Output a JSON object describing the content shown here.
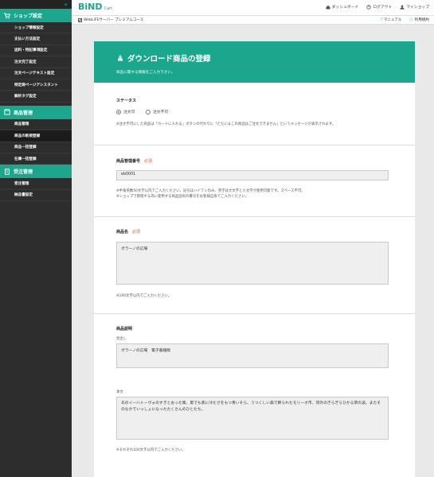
{
  "sidebar": {
    "section1": "ショップ設定",
    "items1": [
      "ショップ情報設定",
      "支払い方法設定",
      "送料・特記事項設定",
      "注文完了設定",
      "注文ページテキスト設定",
      "特定商ページアシスタント",
      "解析タグ設定"
    ],
    "section2": "商品管理",
    "items2": [
      "商品管理",
      "商品の新規登録",
      "商品一括登録",
      "在庫一括登録"
    ],
    "active_item": "商品の新規登録",
    "section3": "受注管理",
    "items3": [
      "受注管理",
      "納品書設定"
    ],
    "collapse_glyph": "«"
  },
  "header": {
    "logo": "BiND",
    "logo_sub": "Cart",
    "nav": [
      {
        "icon": "dashboard-icon",
        "label": "ダッシュボード"
      },
      {
        "icon": "logout-icon",
        "label": "ログアウト"
      },
      {
        "icon": "person-icon",
        "label": "マイショップ"
      }
    ]
  },
  "subbar": {
    "plan": "WebLiFEサーバー プレミアムコース",
    "manual": "マニュアル",
    "terms": "利用規約"
  },
  "page": {
    "title": "ダウンロード商品の登録",
    "subtitle": "商品に関する情報をご入力下さい。",
    "status": {
      "label": "ステータス",
      "options": [
        "注文可",
        "注文不可"
      ],
      "selected": "注文可",
      "note": "※注文不可にした商品は「カートに入れる」ボタンの代わりに「ただいまこの商品はご注文できません」というメッセージが表示されます。"
    },
    "code": {
      "label": "商品管理番号",
      "required": "必須",
      "value": "eb0001",
      "note1": "※半角英数50文字以内でご入力ください。記号はハイフンのみ、英字は大文字と小文字が使用可能です。スペース不可。",
      "note2": "※ショップで管理する為に使用する商品固有の番号をお客様自身でご入力ください。"
    },
    "name": {
      "label": "商品名",
      "required": "必須",
      "value": "ポラーノの広場",
      "note": "※100文字以内でご入力ください。"
    },
    "description": {
      "label": "商品説明",
      "heading_label": "見出し",
      "heading_value": "ポラーノの広場　電子書籍版",
      "body_label": "本文",
      "body_value": "あのイーハトーヴォのすきとおった風、夏でも底に冷たさをもつ青いそら、うつくしい森で飾られたモリーオ市、郊外のぎらぎらひかる草の波。またそのなかでいっしょになったたくさんのひとたち。",
      "note": "※それぞれ100文字以内でご入力ください。"
    }
  }
}
